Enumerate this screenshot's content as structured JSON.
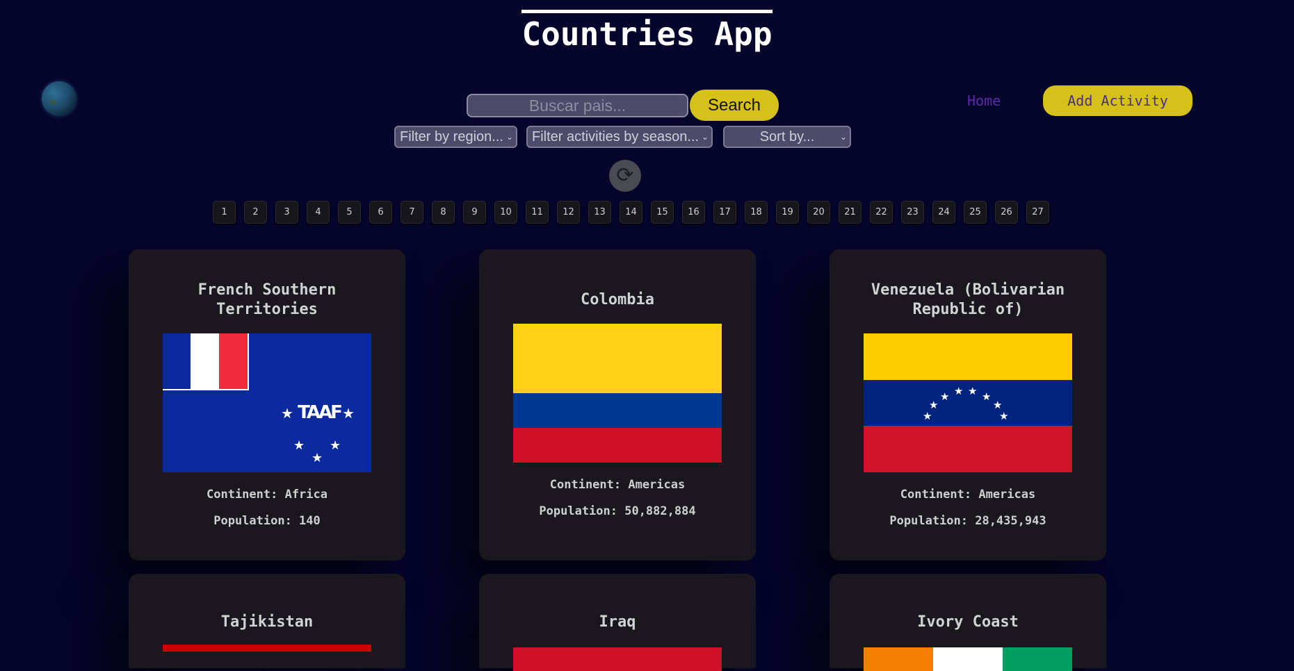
{
  "header": {
    "title": "Countries App"
  },
  "search": {
    "placeholder": "Buscar pais...",
    "button_label": "Search"
  },
  "nav": {
    "home_label": "Home",
    "add_activity_label": "Add Activity"
  },
  "filters": {
    "region": "Filter by region...",
    "season": "Filter activities by season...",
    "sort": "Sort by..."
  },
  "pagination": {
    "pages": [
      "1",
      "2",
      "3",
      "4",
      "5",
      "6",
      "7",
      "8",
      "9",
      "10",
      "11",
      "12",
      "13",
      "14",
      "15",
      "16",
      "17",
      "18",
      "19",
      "20",
      "21",
      "22",
      "23",
      "24",
      "25",
      "26",
      "27"
    ]
  },
  "cards": [
    {
      "name": "French Southern Territories",
      "continent": "Continent: Africa",
      "population": "Population: 140"
    },
    {
      "name": "Colombia",
      "continent": "Continent: Americas",
      "population": "Population: 50,882,884"
    },
    {
      "name": "Venezuela (Bolivarian Republic of)",
      "continent": "Continent: Americas",
      "population": "Population: 28,435,943"
    },
    {
      "name": "Tajikistan"
    },
    {
      "name": "Iraq"
    },
    {
      "name": "Ivory Coast"
    }
  ],
  "flag_glyphs": {
    "star": "★",
    "tf_monogram": "TAAF"
  },
  "icons": {
    "globe": "globe-icon",
    "reload": "reload-icon",
    "dropdown": "chevron-down-icon"
  },
  "colors": {
    "background": "#06052b",
    "accent": "#d5c11a",
    "home_link": "#5b2ca8",
    "card": "#1a181e"
  }
}
